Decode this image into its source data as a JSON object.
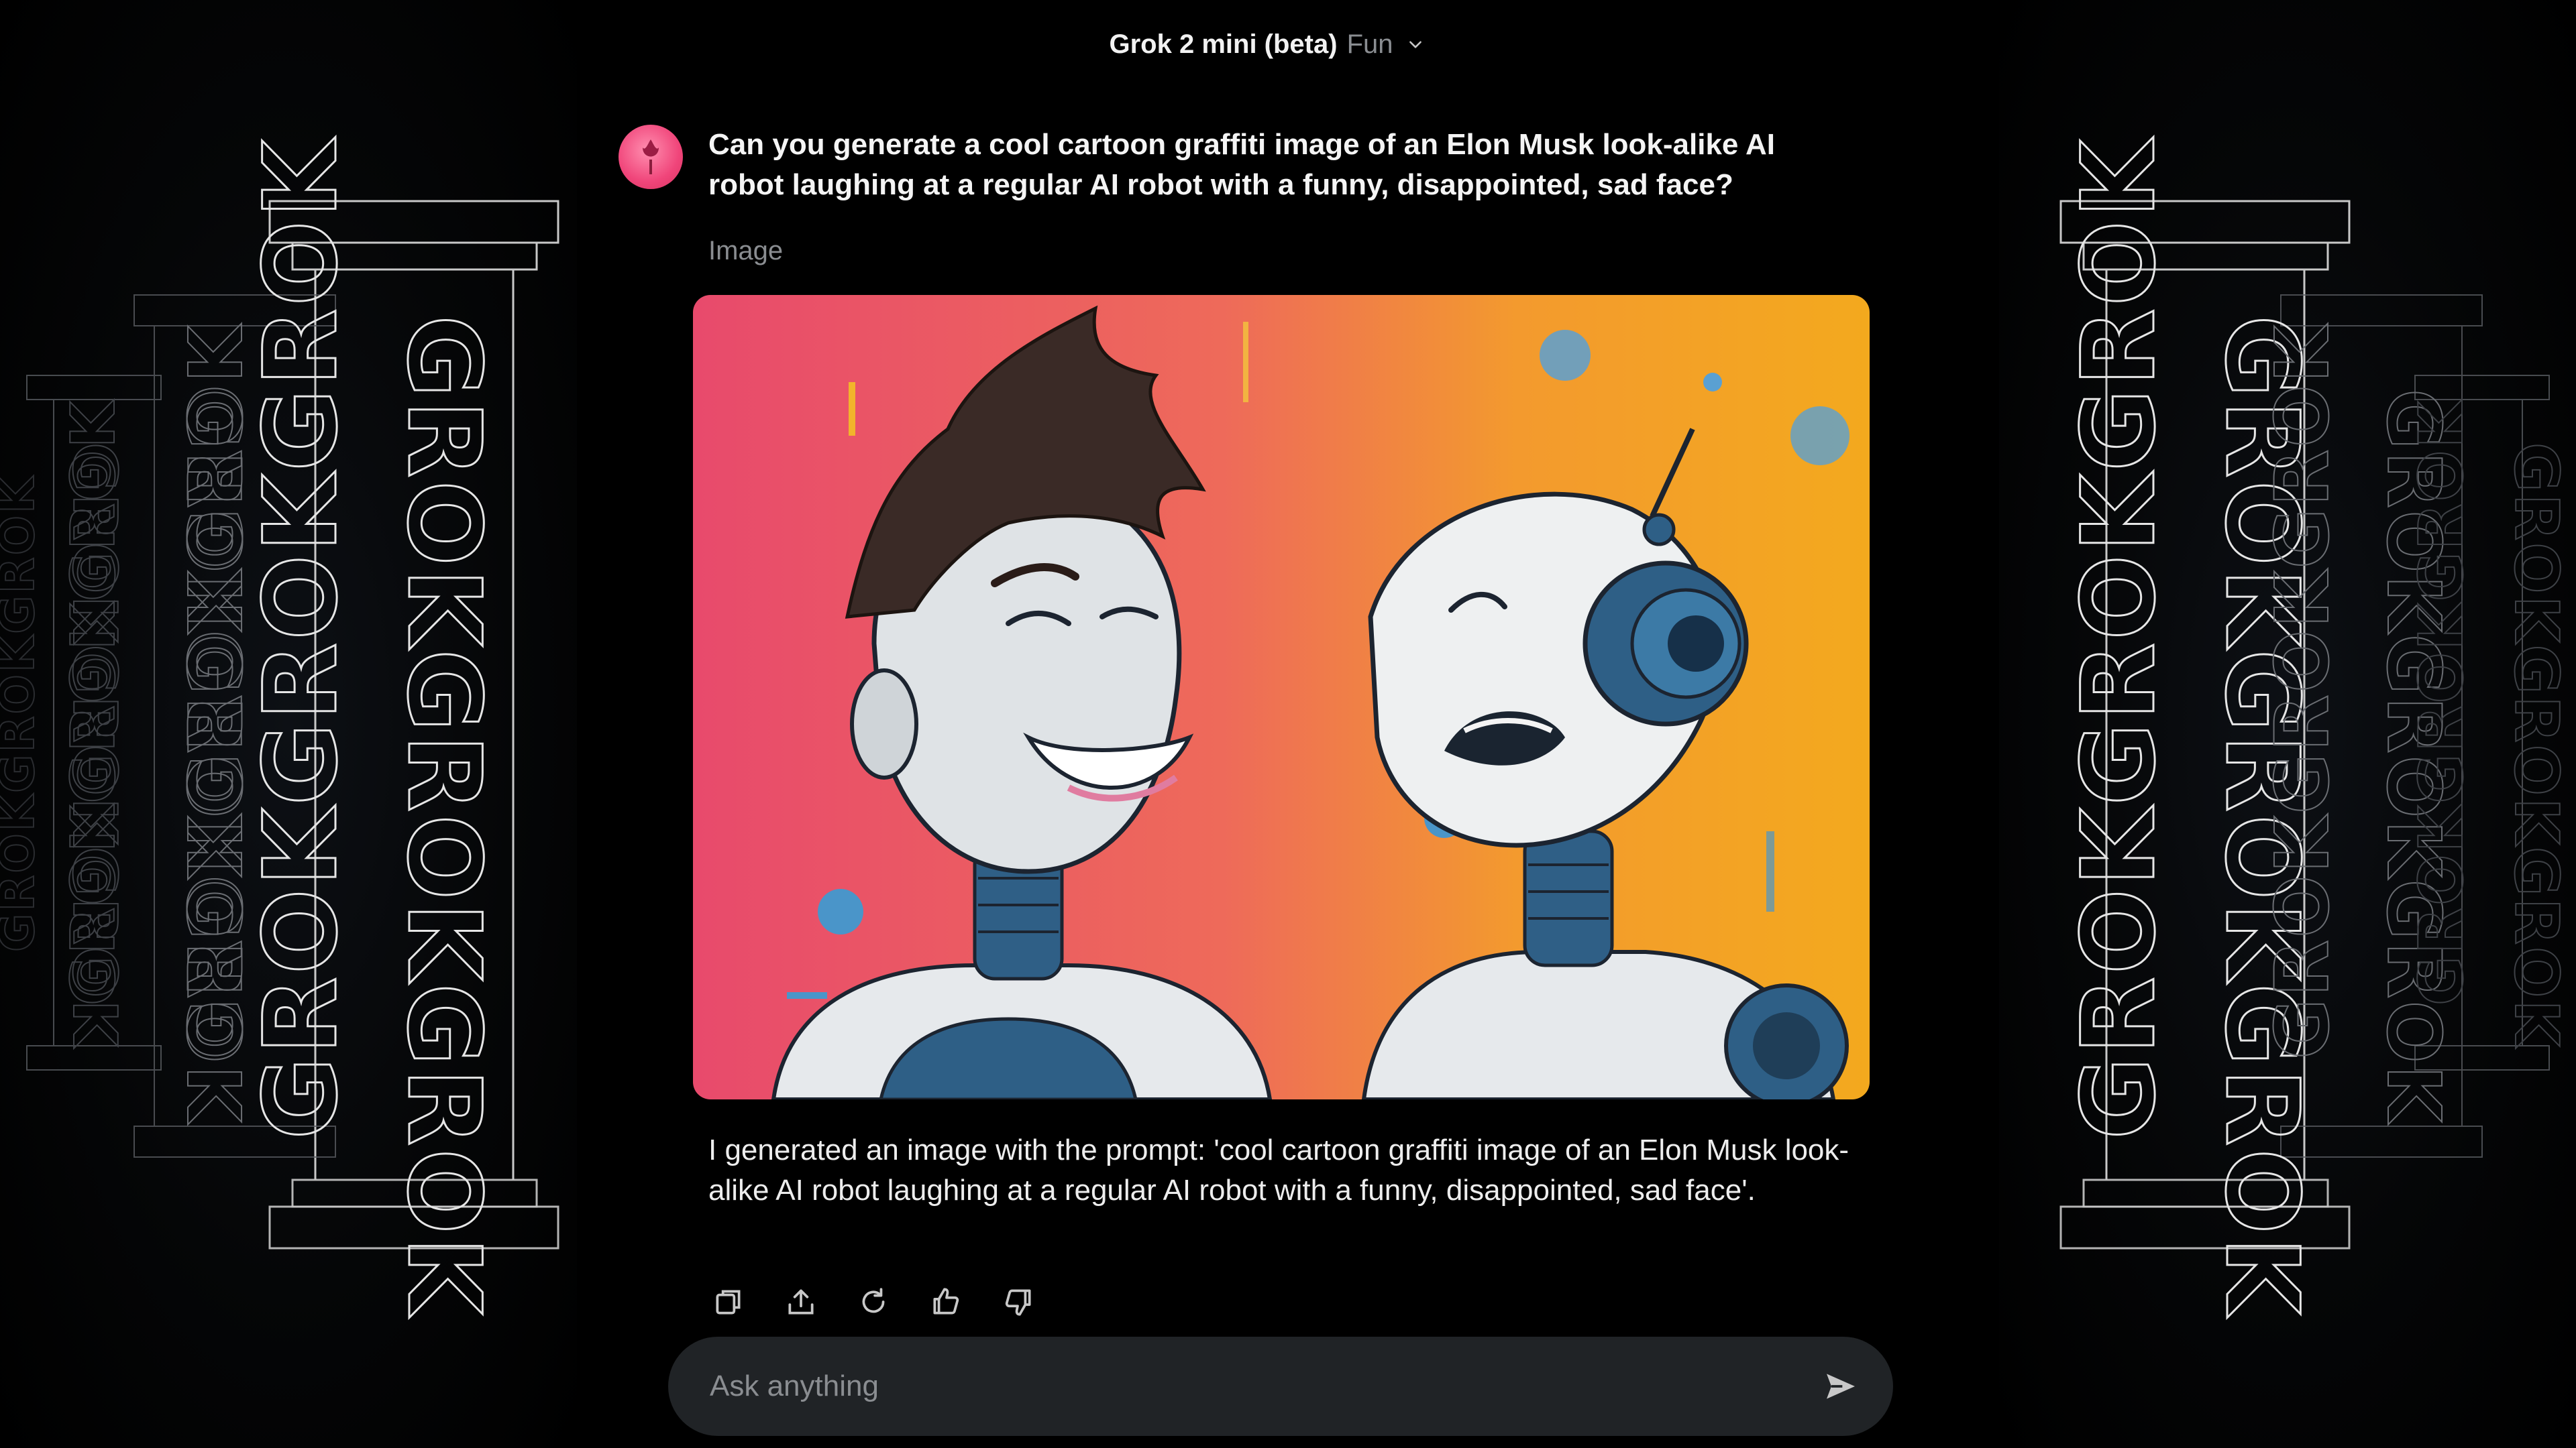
{
  "header": {
    "model_name": "Grok 2 mini (beta)",
    "mode": "Fun"
  },
  "conversation": {
    "user_message": "Can you generate a cool cartoon graffiti image of an Elon Musk look-alike AI robot laughing at a regular AI robot with a funny, disappointed, sad face?",
    "image_label": "Image",
    "reply": "I generated an image with the prompt: 'cool cartoon graffiti image of an Elon Musk look-alike AI robot laughing at a regular AI robot with a funny, disappointed, sad face'."
  },
  "actions": [
    "copy-icon",
    "share-icon",
    "regenerate-icon",
    "thumbs-up-icon",
    "thumbs-down-icon"
  ],
  "composer": {
    "placeholder": "Ask anything"
  },
  "decor": {
    "side_text": "GROK"
  },
  "colors": {
    "background": "#000000",
    "composer_bg": "#202326",
    "muted_text": "#8a8d91",
    "avatar_pink": "#f0457a"
  }
}
